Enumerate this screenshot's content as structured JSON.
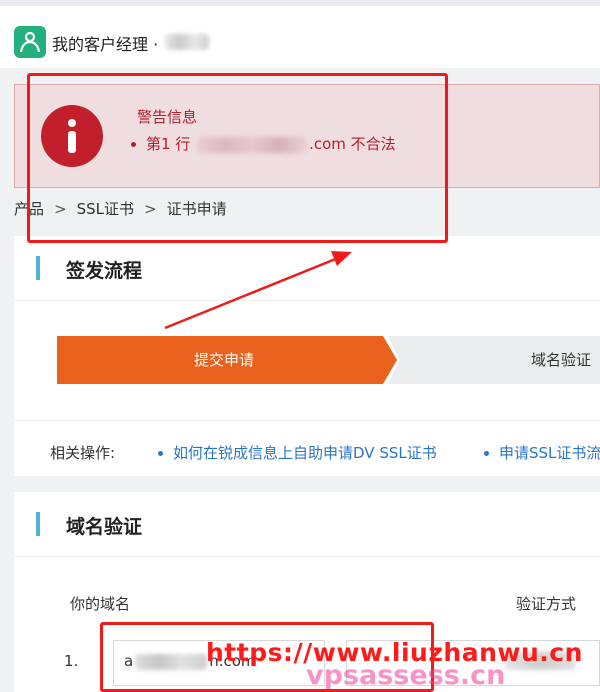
{
  "header": {
    "title": "我的客户经理 ·"
  },
  "alert": {
    "title": "警告信息",
    "item_prefix": "第1 行",
    "item_suffix": ".com 不合法"
  },
  "breadcrumb": [
    "产品",
    "SSL证书",
    "证书申请"
  ],
  "issuance": {
    "title": "签发流程",
    "steps": [
      {
        "label": "提交申请",
        "active": true
      },
      {
        "label": "域名验证",
        "active": false
      }
    ],
    "related_label": "相关操作:",
    "related_links": [
      "如何在锐成信息上自助申请DV SSL证书",
      "申请SSL证书流"
    ]
  },
  "domain_verification": {
    "title": "域名验证",
    "col_domain": "你的域名",
    "col_method": "验证方式",
    "rows": [
      {
        "num": "1.",
        "domain_prefix": "a",
        "domain_suffix": "n.com"
      }
    ]
  },
  "watermark": {
    "text": "https://www.liuzhanwu.cn",
    "text2": "vpsassess.cn"
  },
  "colors": {
    "accent_orange": "#e9611c",
    "alert_red": "#b0202c",
    "brand_green": "#22b07d",
    "link_blue": "#2a76c6",
    "section_bar": "#4fb3d9",
    "annotation_red": "#f01a1a"
  },
  "icons": {
    "brand": "user-pair-icon",
    "alert": "info-icon"
  }
}
